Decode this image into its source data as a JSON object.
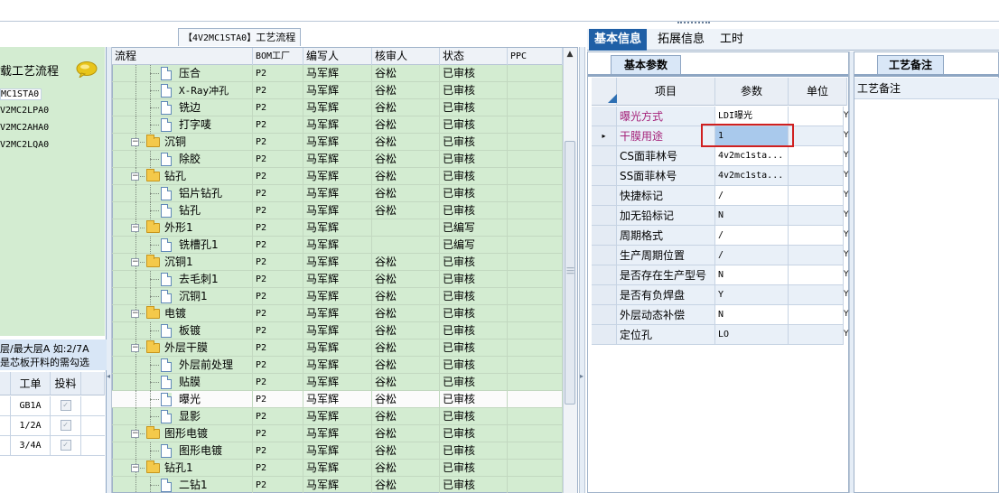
{
  "left": {
    "title": "载工艺流程",
    "tree_items": [
      "MC1STA0",
      "V2MC2LPA0",
      "V2MC2AHA0",
      "V2MC2LQA0"
    ],
    "hint_line1": "层/最大层A 如:2/7A",
    "hint_line2": "是芯板开料的需勾选",
    "grid_headers": [
      "工单",
      "投料"
    ],
    "grid_rows": [
      {
        "order": "GB1A",
        "checked": "✓"
      },
      {
        "order": "1/2A",
        "checked": "✓"
      },
      {
        "order": "3/4A",
        "checked": "✓"
      }
    ]
  },
  "process": {
    "caption_code": "【4V2MC1STA0】",
    "caption_text": "工艺流程",
    "headers": [
      "流程",
      "BOM工厂",
      "编写人",
      "核审人",
      "状态",
      "PPC"
    ],
    "rows": [
      {
        "name": "压合",
        "type": "doc",
        "bom": "P2",
        "writer": "马军辉",
        "reviewer": "谷松",
        "status": "已审核"
      },
      {
        "name": "X-Ray冲孔",
        "type": "doc",
        "bom": "P2",
        "writer": "马军辉",
        "reviewer": "谷松",
        "status": "已审核"
      },
      {
        "name": "铣边",
        "type": "doc",
        "bom": "P2",
        "writer": "马军辉",
        "reviewer": "谷松",
        "status": "已审核"
      },
      {
        "name": "打字唛",
        "type": "doc",
        "bom": "P2",
        "writer": "马军辉",
        "reviewer": "谷松",
        "status": "已审核"
      },
      {
        "name": "沉铜",
        "type": "folder",
        "bom": "P2",
        "writer": "马军辉",
        "reviewer": "谷松",
        "status": "已审核"
      },
      {
        "name": "除胶",
        "type": "doc",
        "bom": "P2",
        "writer": "马军辉",
        "reviewer": "谷松",
        "status": "已审核"
      },
      {
        "name": "钻孔",
        "type": "folder",
        "bom": "P2",
        "writer": "马军辉",
        "reviewer": "谷松",
        "status": "已审核"
      },
      {
        "name": "铝片钻孔",
        "type": "doc",
        "bom": "P2",
        "writer": "马军辉",
        "reviewer": "谷松",
        "status": "已审核"
      },
      {
        "name": "钻孔",
        "type": "doc",
        "bom": "P2",
        "writer": "马军辉",
        "reviewer": "谷松",
        "status": "已审核"
      },
      {
        "name": "外形1",
        "type": "folder",
        "bom": "P2",
        "writer": "马军辉",
        "reviewer": "",
        "status": "已编写"
      },
      {
        "name": "铣槽孔1",
        "type": "doc",
        "bom": "P2",
        "writer": "马军辉",
        "reviewer": "",
        "status": "已编写"
      },
      {
        "name": "沉铜1",
        "type": "folder",
        "bom": "P2",
        "writer": "马军辉",
        "reviewer": "谷松",
        "status": "已审核"
      },
      {
        "name": "去毛刺1",
        "type": "doc",
        "bom": "P2",
        "writer": "马军辉",
        "reviewer": "谷松",
        "status": "已审核"
      },
      {
        "name": "沉铜1",
        "type": "doc",
        "bom": "P2",
        "writer": "马军辉",
        "reviewer": "谷松",
        "status": "已审核"
      },
      {
        "name": "电镀",
        "type": "folder",
        "bom": "P2",
        "writer": "马军辉",
        "reviewer": "谷松",
        "status": "已审核"
      },
      {
        "name": "板镀",
        "type": "doc",
        "bom": "P2",
        "writer": "马军辉",
        "reviewer": "谷松",
        "status": "已审核"
      },
      {
        "name": "外层干膜",
        "type": "folder",
        "bom": "P2",
        "writer": "马军辉",
        "reviewer": "谷松",
        "status": "已审核"
      },
      {
        "name": "外层前处理",
        "type": "doc",
        "bom": "P2",
        "writer": "马军辉",
        "reviewer": "谷松",
        "status": "已审核"
      },
      {
        "name": "贴膜",
        "type": "doc",
        "bom": "P2",
        "writer": "马军辉",
        "reviewer": "谷松",
        "status": "已审核"
      },
      {
        "name": "曝光",
        "type": "doc",
        "bom": "P2",
        "writer": "马军辉",
        "reviewer": "谷松",
        "status": "已审核",
        "selected": true
      },
      {
        "name": "显影",
        "type": "doc",
        "bom": "P2",
        "writer": "马军辉",
        "reviewer": "谷松",
        "status": "已审核"
      },
      {
        "name": "图形电镀",
        "type": "folder",
        "bom": "P2",
        "writer": "马军辉",
        "reviewer": "谷松",
        "status": "已审核"
      },
      {
        "name": "图形电镀",
        "type": "doc",
        "bom": "P2",
        "writer": "马军辉",
        "reviewer": "谷松",
        "status": "已审核"
      },
      {
        "name": "钻孔1",
        "type": "folder",
        "bom": "P2",
        "writer": "马军辉",
        "reviewer": "谷松",
        "status": "已审核"
      },
      {
        "name": "二钻1",
        "type": "doc",
        "bom": "P2",
        "writer": "马军辉",
        "reviewer": "谷松",
        "status": "已审核"
      }
    ]
  },
  "right": {
    "tabs": [
      "基本信息",
      "拓展信息",
      "工时"
    ],
    "param_tab": "基本参数",
    "param_headers": [
      "项目",
      "参数",
      "单位"
    ],
    "params": [
      {
        "item": "曝光方式",
        "value": "LDI曝光",
        "pink": true
      },
      {
        "item": "干膜用途",
        "value": "1",
        "pink": true,
        "editing": true
      },
      {
        "item": "CS面菲林号",
        "value": "4v2mc1sta..."
      },
      {
        "item": "SS面菲林号",
        "value": "4v2mc1sta..."
      },
      {
        "item": "快捷标记",
        "value": "/"
      },
      {
        "item": "加无铅标记",
        "value": "N"
      },
      {
        "item": "周期格式",
        "value": "/"
      },
      {
        "item": "生产周期位置",
        "value": "/"
      },
      {
        "item": "是否存在生产型号",
        "value": "N"
      },
      {
        "item": "是否有负焊盘",
        "value": "Y"
      },
      {
        "item": "外层动态补偿",
        "value": "N"
      },
      {
        "item": "定位孔",
        "value": "LO"
      }
    ],
    "note_tab": "工艺备注",
    "note_label": "工艺备注",
    "row_marker": "▸",
    "edge_mark": "Y"
  },
  "colors": {
    "tree_bg": "#d3ecd1",
    "active_tab": "#1f5fa6",
    "highlight_box": "#d02020",
    "pink_text": "#a5237a"
  }
}
